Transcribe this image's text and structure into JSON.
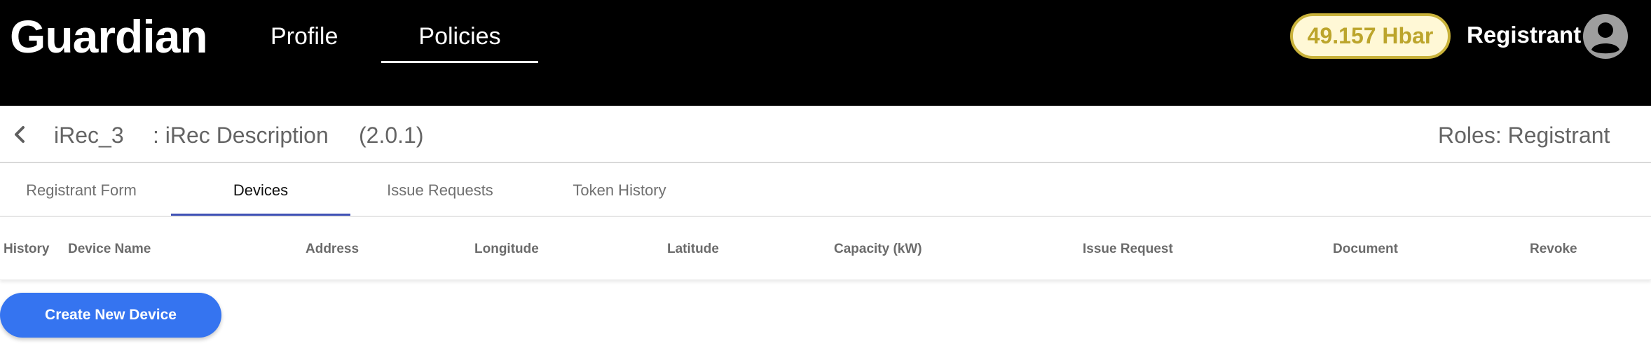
{
  "header": {
    "brand": "Guardian",
    "nav": [
      {
        "label": "Profile",
        "active": false
      },
      {
        "label": "Policies",
        "active": true
      }
    ],
    "balance": "49.157 Hbar",
    "user": "Registrant",
    "user_icon": "account-circle-icon"
  },
  "policy": {
    "back_icon": "chevron-left-icon",
    "name": "iRec_3",
    "description": ": iRec Description",
    "version": "(2.0.1)",
    "roles": "Roles: Registrant"
  },
  "tabs": [
    {
      "label": "Registrant Form",
      "active": false
    },
    {
      "label": "Devices",
      "active": true
    },
    {
      "label": "Issue Requests",
      "active": false
    },
    {
      "label": "Token History",
      "active": false
    }
  ],
  "table": {
    "columns": [
      "History",
      "Device Name",
      "Address",
      "Longitude",
      "Latitude",
      "Capacity (kW)",
      "Issue Request",
      "Document",
      "Revoke"
    ],
    "rows": []
  },
  "actions": {
    "create_label": "Create New Device"
  },
  "colors": {
    "header_bg": "#000000",
    "accent": "#3574f0",
    "tab_ink": "#3f51b5",
    "balance_text": "#bca52c",
    "balance_border": "#c9b23a"
  }
}
